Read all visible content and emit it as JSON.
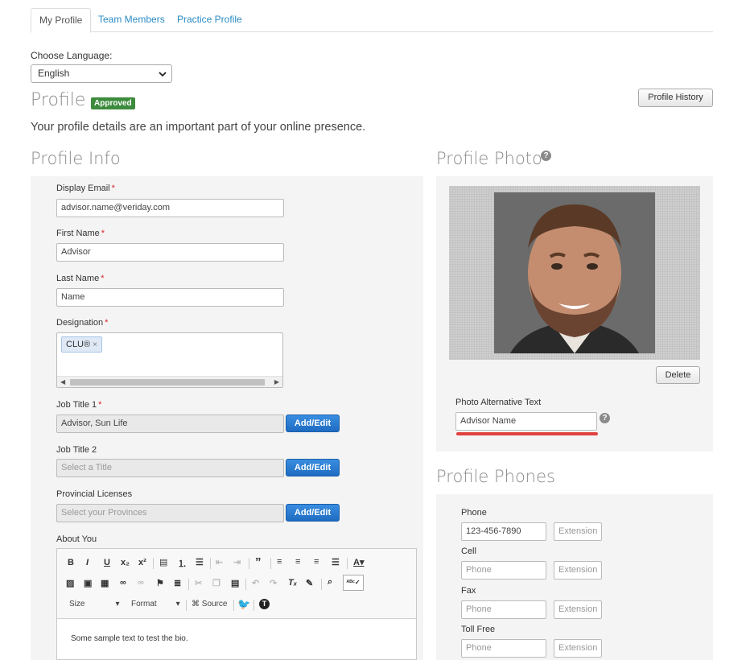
{
  "tabs": [
    {
      "label": "My Profile",
      "active": true
    },
    {
      "label": "Team Members",
      "active": false
    },
    {
      "label": "Practice Profile",
      "active": false
    }
  ],
  "language": {
    "label": "Choose Language:",
    "selected": "English"
  },
  "profile": {
    "title": "Profile",
    "status_badge": "Approved",
    "history_button": "Profile History",
    "subtitle": "Your profile details are an important part of your online presence."
  },
  "profile_info": {
    "title": "Profile Info",
    "display_email": {
      "label": "Display Email",
      "value": "advisor.name@veriday.com"
    },
    "first_name": {
      "label": "First Name",
      "value": "Advisor"
    },
    "last_name": {
      "label": "Last Name",
      "value": "Name"
    },
    "designation": {
      "label": "Designation",
      "chips": [
        "CLU®"
      ]
    },
    "job_title_1": {
      "label": "Job Title 1",
      "value": "Advisor, Sun Life",
      "button": "Add/Edit"
    },
    "job_title_2": {
      "label": "Job Title 2",
      "placeholder": "Select a Title",
      "button": "Add/Edit"
    },
    "provincial_licenses": {
      "label": "Provincial Licenses",
      "placeholder": "Select your Provinces",
      "button": "Add/Edit"
    },
    "about_you": {
      "label": "About You",
      "toolbar": {
        "size_label": "Size",
        "format_label": "Format",
        "source_label": "Source"
      },
      "content": "Some sample text to test the bio."
    }
  },
  "profile_photo": {
    "title": "Profile Photo",
    "delete_button": "Delete",
    "alt_text": {
      "label": "Photo Alternative Text",
      "value": "Advisor Name"
    }
  },
  "profile_phones": {
    "title": "Profile Phones",
    "fields": [
      {
        "label": "Phone",
        "value": "123-456-7890",
        "placeholder": "Phone",
        "ext_placeholder": "Extension"
      },
      {
        "label": "Cell",
        "value": "",
        "placeholder": "Phone",
        "ext_placeholder": "Extension"
      },
      {
        "label": "Fax",
        "value": "",
        "placeholder": "Phone",
        "ext_placeholder": "Extension"
      },
      {
        "label": "Toll Free",
        "value": "",
        "placeholder": "Phone",
        "ext_placeholder": "Extension"
      }
    ]
  },
  "colors": {
    "accent": "#2a8bc4",
    "badge": "#3d8b3d",
    "primary_button": "#1e6cc2",
    "required": "#d9242a",
    "highlight": "#e0413f"
  }
}
